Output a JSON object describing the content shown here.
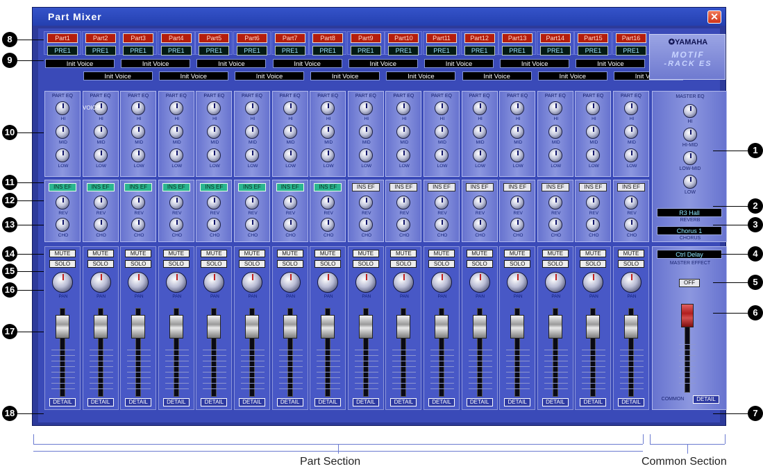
{
  "window": {
    "title": "Part Mixer",
    "close_symbol": "✕"
  },
  "parts": [
    {
      "part": "Part1",
      "bank": "PRE1",
      "voice": "Init Voice",
      "ins_ef": "INS EF",
      "ins_on": true
    },
    {
      "part": "Part2",
      "bank": "PRE1",
      "voice": "Init Voice",
      "ins_ef": "INS EF",
      "ins_on": true
    },
    {
      "part": "Part3",
      "bank": "PRE1",
      "voice": "Init Voice",
      "ins_ef": "INS EF",
      "ins_on": true
    },
    {
      "part": "Part4",
      "bank": "PRE1",
      "voice": "Init Voice",
      "ins_ef": "INS EF",
      "ins_on": true
    },
    {
      "part": "Part5",
      "bank": "PRE1",
      "voice": "Init Voice",
      "ins_ef": "INS EF",
      "ins_on": true
    },
    {
      "part": "Part6",
      "bank": "PRE1",
      "voice": "Init Voice",
      "ins_ef": "INS EF",
      "ins_on": true
    },
    {
      "part": "Part7",
      "bank": "PRE1",
      "voice": "Init Voice",
      "ins_ef": "INS EF",
      "ins_on": true
    },
    {
      "part": "Part8",
      "bank": "PRE1",
      "voice": "Init Voice",
      "ins_ef": "INS EF",
      "ins_on": true
    },
    {
      "part": "Part9",
      "bank": "PRE1",
      "voice": "Init Voice",
      "ins_ef": "INS EF",
      "ins_on": false
    },
    {
      "part": "Part10",
      "bank": "PRE1",
      "voice": "Init Voice",
      "ins_ef": "INS EF",
      "ins_on": false
    },
    {
      "part": "Part11",
      "bank": "PRE1",
      "voice": "Init Voice",
      "ins_ef": "INS EF",
      "ins_on": false
    },
    {
      "part": "Part12",
      "bank": "PRE1",
      "voice": "Init Voice",
      "ins_ef": "INS EF",
      "ins_on": false
    },
    {
      "part": "Part13",
      "bank": "PRE1",
      "voice": "Init Voice",
      "ins_ef": "INS EF",
      "ins_on": false
    },
    {
      "part": "Part14",
      "bank": "PRE1",
      "voice": "Init Voice",
      "ins_ef": "INS EF",
      "ins_on": false
    },
    {
      "part": "Part15",
      "bank": "PRE1",
      "voice": "Init Voice",
      "ins_ef": "INS EF",
      "ins_on": false
    },
    {
      "part": "Part16",
      "bank": "PRE1",
      "voice": "Init Voice",
      "ins_ef": "INS EF",
      "ins_on": false
    }
  ],
  "labels": {
    "voice": "VOICE",
    "part_eq": "PART EQ",
    "hi": "HI",
    "mid": "MID",
    "low": "LOW",
    "rev": "REV",
    "cho": "CHO",
    "mute": "MUTE",
    "solo": "SOLO",
    "pan": "PAN",
    "detail": "DETAIL"
  },
  "brand": {
    "maker": "✪YAMAHA",
    "model_line1": "MOTIF",
    "model_line2": "-RACK ES"
  },
  "common": {
    "master_eq": "MASTER EQ",
    "hi": "HI",
    "hi_mid": "HI-MID",
    "low_mid": "LOW-MID",
    "low": "LOW",
    "reverb_value": "R3  Hall",
    "reverb_label": "REVERB",
    "chorus_value": "Chorus 1",
    "chorus_label": "CHORUS",
    "master_effect_value": "Ctrl Delay",
    "master_effect_label": "MASTER EFFECT",
    "master_effect_toggle": "OFF",
    "common_label": "COMMON",
    "detail": "DETAIL"
  },
  "callouts": [
    "1",
    "2",
    "3",
    "4",
    "5",
    "6",
    "7",
    "8",
    "9",
    "10",
    "11",
    "12",
    "13",
    "14",
    "15",
    "16",
    "17",
    "18"
  ],
  "captions": {
    "part_section": "Part Section",
    "common_section": "Common Section"
  },
  "colors": {
    "panel_blue": "#3a4ab8",
    "part_red": "#b41d0c",
    "ins_green": "#2ab58f",
    "master_fader_red": "#b11e1e"
  }
}
